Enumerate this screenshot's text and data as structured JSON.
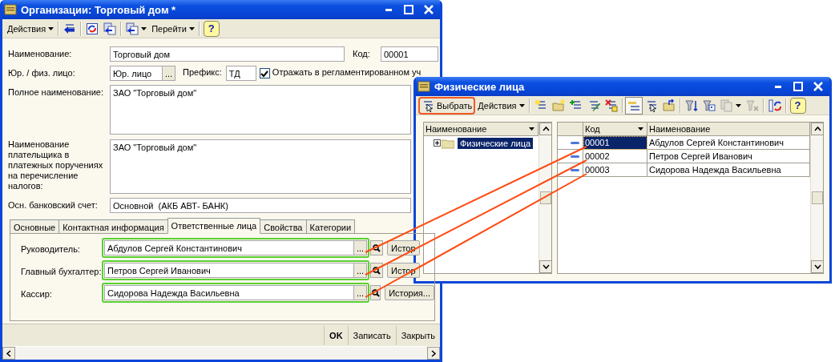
{
  "main_window": {
    "title": "Организации: Торговый дом *",
    "toolbar": [
      {
        "kind": "menu",
        "label": "Действия"
      },
      {
        "kind": "separator"
      },
      {
        "kind": "icon"
      },
      {
        "kind": "separator"
      },
      {
        "kind": "icon"
      },
      {
        "kind": "icon"
      },
      {
        "kind": "separator"
      },
      {
        "kind": "icon_menu"
      },
      {
        "kind": "menu",
        "label": "Перейти"
      },
      {
        "kind": "separator"
      },
      {
        "kind": "help",
        "label": "?"
      }
    ],
    "form": {
      "name_label": "Наименование:",
      "name": "Торговый дом",
      "code_label": "Код:",
      "code": "00001",
      "type_label": "Юр. / физ. лицо:",
      "type": "Юр. лицо",
      "type_button": "...",
      "prefix_label": "Префикс:",
      "prefix": "ТД",
      "reflect": {
        "label": "Отражать в регламентированном уч",
        "checked": true
      },
      "full_name_label": "Полное наименование:",
      "full_name": "ЗАО \"Торговый дом\"",
      "payer_label": "Наименование плательщика в платежных поручениях на перечисление налогов:",
      "payer_name": "ЗАО \"Торговый дом\"",
      "bank_label": "Осн. банковский счет:",
      "bank": "Основной  (АКБ АВТ- БАНК)"
    },
    "tabs": [
      {
        "label": "Основные",
        "selected": false
      },
      {
        "label": "Контактная информация",
        "selected": false
      },
      {
        "label": "Ответственные лица",
        "selected": true
      },
      {
        "label": "Свойства",
        "selected": false
      },
      {
        "label": "Категории",
        "selected": false
      }
    ],
    "responsible": [
      {
        "label": "Руководитель:",
        "value": "Абдулов Сергей Константинович",
        "dots": "...",
        "history": "Истор",
        "highlighted": true
      },
      {
        "label": "Главный бухгалтер:",
        "value": "Петров Сергей Иванович",
        "dots": "...",
        "history": "Истор",
        "highlighted": true
      },
      {
        "label": "Кассир:",
        "value": "Сидорова Надежда Васильевна",
        "dots": "...",
        "history": "История...",
        "highlighted": true
      }
    ],
    "buttons": [
      {
        "label": "OK",
        "default": true
      },
      {
        "label": "Записать",
        "default": false
      },
      {
        "label": "Закрыть",
        "default": false
      }
    ]
  },
  "picker_window": {
    "title": "Физические лица",
    "toolbar": [
      {
        "kind": "text_button",
        "label": "Выбрать",
        "highlighted": true
      },
      {
        "kind": "menu",
        "label": "Действия"
      },
      {
        "kind": "separator"
      },
      {
        "kind": "icon",
        "pressed": false,
        "disabled": false
      },
      {
        "kind": "icon",
        "pressed": false,
        "disabled": false
      },
      {
        "kind": "icon",
        "pressed": false,
        "disabled": false
      },
      {
        "kind": "icon",
        "pressed": false,
        "disabled": false
      },
      {
        "kind": "icon",
        "pressed": false,
        "disabled": false
      },
      {
        "kind": "separator"
      },
      {
        "kind": "icon",
        "pressed": true,
        "disabled": false
      },
      {
        "kind": "icon",
        "pressed": false,
        "disabled": false
      },
      {
        "kind": "icon",
        "pressed": false,
        "disabled": false
      },
      {
        "kind": "separator"
      },
      {
        "kind": "icon",
        "pressed": false,
        "disabled": false
      },
      {
        "kind": "icon",
        "pressed": false,
        "disabled": false
      },
      {
        "kind": "icon_menu",
        "pressed": false,
        "disabled": true
      },
      {
        "kind": "icon",
        "pressed": false,
        "disabled": true
      },
      {
        "kind": "separator"
      },
      {
        "kind": "icon",
        "pressed": false,
        "disabled": false
      },
      {
        "kind": "separator"
      },
      {
        "kind": "help",
        "label": "?"
      }
    ],
    "tree": {
      "column": "Наименование",
      "items": [
        {
          "label": "Физические лица",
          "selected": true,
          "expanded": false
        }
      ]
    },
    "table": {
      "columns": [
        "Код",
        "Наименование"
      ],
      "rows": [
        {
          "code": "00001",
          "name": "Абдулов Сергей Константинович",
          "selected": true
        },
        {
          "code": "00002",
          "name": "Петров Сергей Иванович",
          "selected": false
        },
        {
          "code": "00003",
          "name": "Сидорова Надежда Васильевна",
          "selected": false
        }
      ]
    }
  }
}
